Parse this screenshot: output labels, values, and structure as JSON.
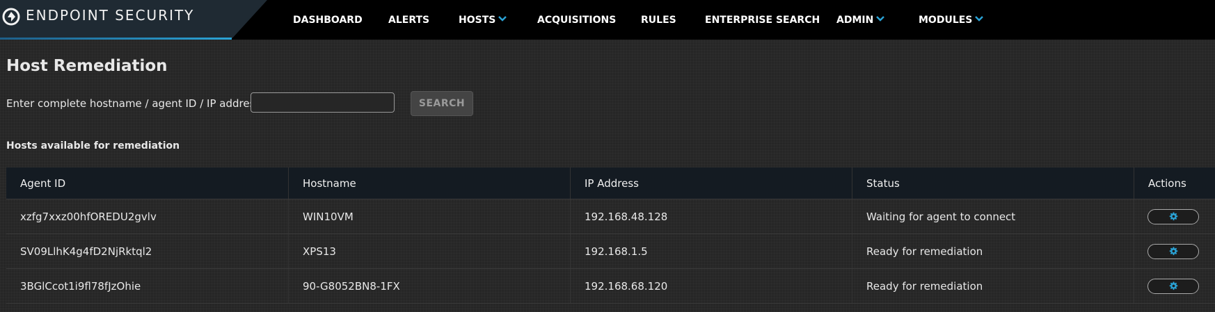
{
  "brand": {
    "name": "ENDPOINT SECURITY"
  },
  "nav": {
    "items": [
      {
        "label": "DASHBOARD",
        "has_menu": false
      },
      {
        "label": "ALERTS",
        "has_menu": false
      },
      {
        "label": "HOSTS",
        "has_menu": true
      },
      {
        "label": "ACQUISITIONS",
        "has_menu": false
      },
      {
        "label": "RULES",
        "has_menu": false
      },
      {
        "label": "ENTERPRISE SEARCH",
        "has_menu": false
      },
      {
        "label": "ADMIN",
        "has_menu": true
      },
      {
        "label": "MODULES",
        "has_menu": true
      }
    ],
    "chevron_color": "#2aa3d6"
  },
  "page": {
    "title": "Host Remediation",
    "search_label": "Enter complete hostname / agent ID / IP address",
    "search_value": "",
    "search_placeholder": "",
    "search_button": "SEARCH",
    "section_title": "Hosts available for remediation"
  },
  "table": {
    "columns": [
      "Agent ID",
      "Hostname",
      "IP Address",
      "Status",
      "Actions"
    ],
    "rows": [
      {
        "agent_id": "xzfg7xxz00hfOREDU2gvlv",
        "hostname": "WIN10VM",
        "ip": "192.168.48.128",
        "status": "Waiting for agent to connect",
        "action_icon": "gear-icon"
      },
      {
        "agent_id": "SV09LlhK4g4fD2NjRktql2",
        "hostname": "XPS13",
        "ip": "192.168.1.5",
        "status": "Ready for remediation",
        "action_icon": "gear-icon"
      },
      {
        "agent_id": "3BGlCcot1i9fl78fJzOhie",
        "hostname": "90-G8052BN8-1FX",
        "ip": "192.168.68.120",
        "status": "Ready for remediation",
        "action_icon": "gear-icon"
      }
    ]
  },
  "colors": {
    "accent": "#2aa3d6",
    "header_bg": "#000000",
    "page_bg": "#262626",
    "table_header_bg": "#141b22"
  }
}
